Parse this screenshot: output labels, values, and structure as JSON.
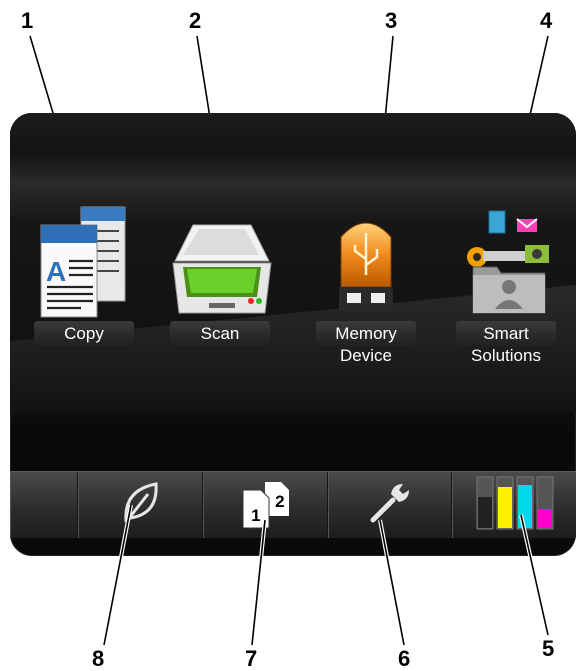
{
  "callouts": [
    "1",
    "2",
    "3",
    "4",
    "5",
    "6",
    "7",
    "8"
  ],
  "apps": [
    {
      "label": "Copy",
      "icon": "copy-icon"
    },
    {
      "label": "Scan",
      "icon": "scanner-icon"
    },
    {
      "label": "Memory\nDevice",
      "icon": "usb-drive-icon"
    },
    {
      "label": "Smart\nSolutions",
      "icon": "smart-solutions-icon"
    }
  ],
  "bottom_bar": [
    {
      "icon": "blank-tab"
    },
    {
      "icon": "leaf-icon"
    },
    {
      "icon": "duplex-pages-icon",
      "pages": [
        "1",
        "2"
      ]
    },
    {
      "icon": "wrench-icon"
    },
    {
      "icon": "ink-levels-icon"
    }
  ],
  "colors": {
    "panel": "#0a0a0a",
    "ink_yellow": "#ffef00",
    "ink_cyan": "#00d8e8",
    "ink_magenta": "#ff00d0",
    "ink_black": "#222222",
    "scanner_glass": "#57c51a",
    "usb_orange": "#f08a1e"
  }
}
